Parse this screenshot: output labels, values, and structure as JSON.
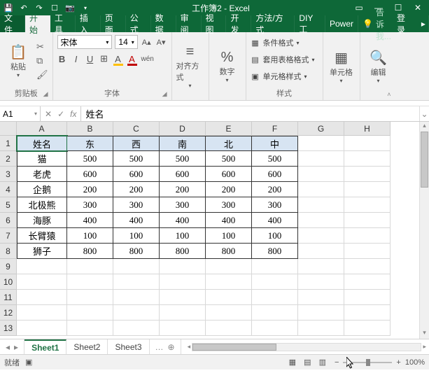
{
  "title": "工作簿2 - Excel",
  "qat": [
    "save",
    "undo",
    "redo",
    "touch",
    "camera"
  ],
  "menutabs": {
    "file": "文件",
    "home": "开始",
    "tools": "工具",
    "insert": "插入",
    "layout": "页面",
    "formulas": "公式",
    "data": "数据",
    "review": "审阅",
    "view": "视图",
    "dev": "开发",
    "methods": "方法/方式",
    "diy": "DIY工",
    "power": "Power"
  },
  "tell_me": "告诉我...",
  "login": "登录",
  "ribbon": {
    "clipboard": {
      "paste": "粘贴",
      "label": "剪贴板"
    },
    "font": {
      "name": "宋体",
      "size": "14",
      "label": "字体"
    },
    "align": {
      "label": "对齐方式"
    },
    "number": {
      "btn": "%",
      "label": "数字"
    },
    "styles": {
      "cond": "条件格式",
      "table": "套用表格格式",
      "cell": "单元格样式",
      "label": "样式"
    },
    "cells": {
      "label": "单元格"
    },
    "editing": {
      "label": "编辑"
    }
  },
  "namebox": "A1",
  "formula": "姓名",
  "columns": [
    "A",
    "B",
    "C",
    "D",
    "E",
    "F",
    "G",
    "H"
  ],
  "header_row": [
    "姓名",
    "东",
    "西",
    "南",
    "北",
    "中"
  ],
  "data_rows": [
    {
      "name": "猫",
      "vals": [
        "500",
        "500",
        "500",
        "500",
        "500"
      ]
    },
    {
      "name": "老虎",
      "vals": [
        "600",
        "600",
        "600",
        "600",
        "600"
      ]
    },
    {
      "name": "企鹅",
      "vals": [
        "200",
        "200",
        "200",
        "200",
        "200"
      ]
    },
    {
      "name": "北极熊",
      "vals": [
        "300",
        "300",
        "300",
        "300",
        "300"
      ]
    },
    {
      "name": "海豚",
      "vals": [
        "400",
        "400",
        "400",
        "400",
        "400"
      ]
    },
    {
      "name": "长臂猿",
      "vals": [
        "100",
        "100",
        "100",
        "100",
        "100"
      ]
    },
    {
      "name": "狮子",
      "vals": [
        "800",
        "800",
        "800",
        "800",
        "800"
      ]
    }
  ],
  "total_rows": 13,
  "sheets": {
    "s1": "Sheet1",
    "s2": "Sheet2",
    "s3": "Sheet3"
  },
  "status": {
    "ready": "就绪",
    "zoom": "100%"
  }
}
